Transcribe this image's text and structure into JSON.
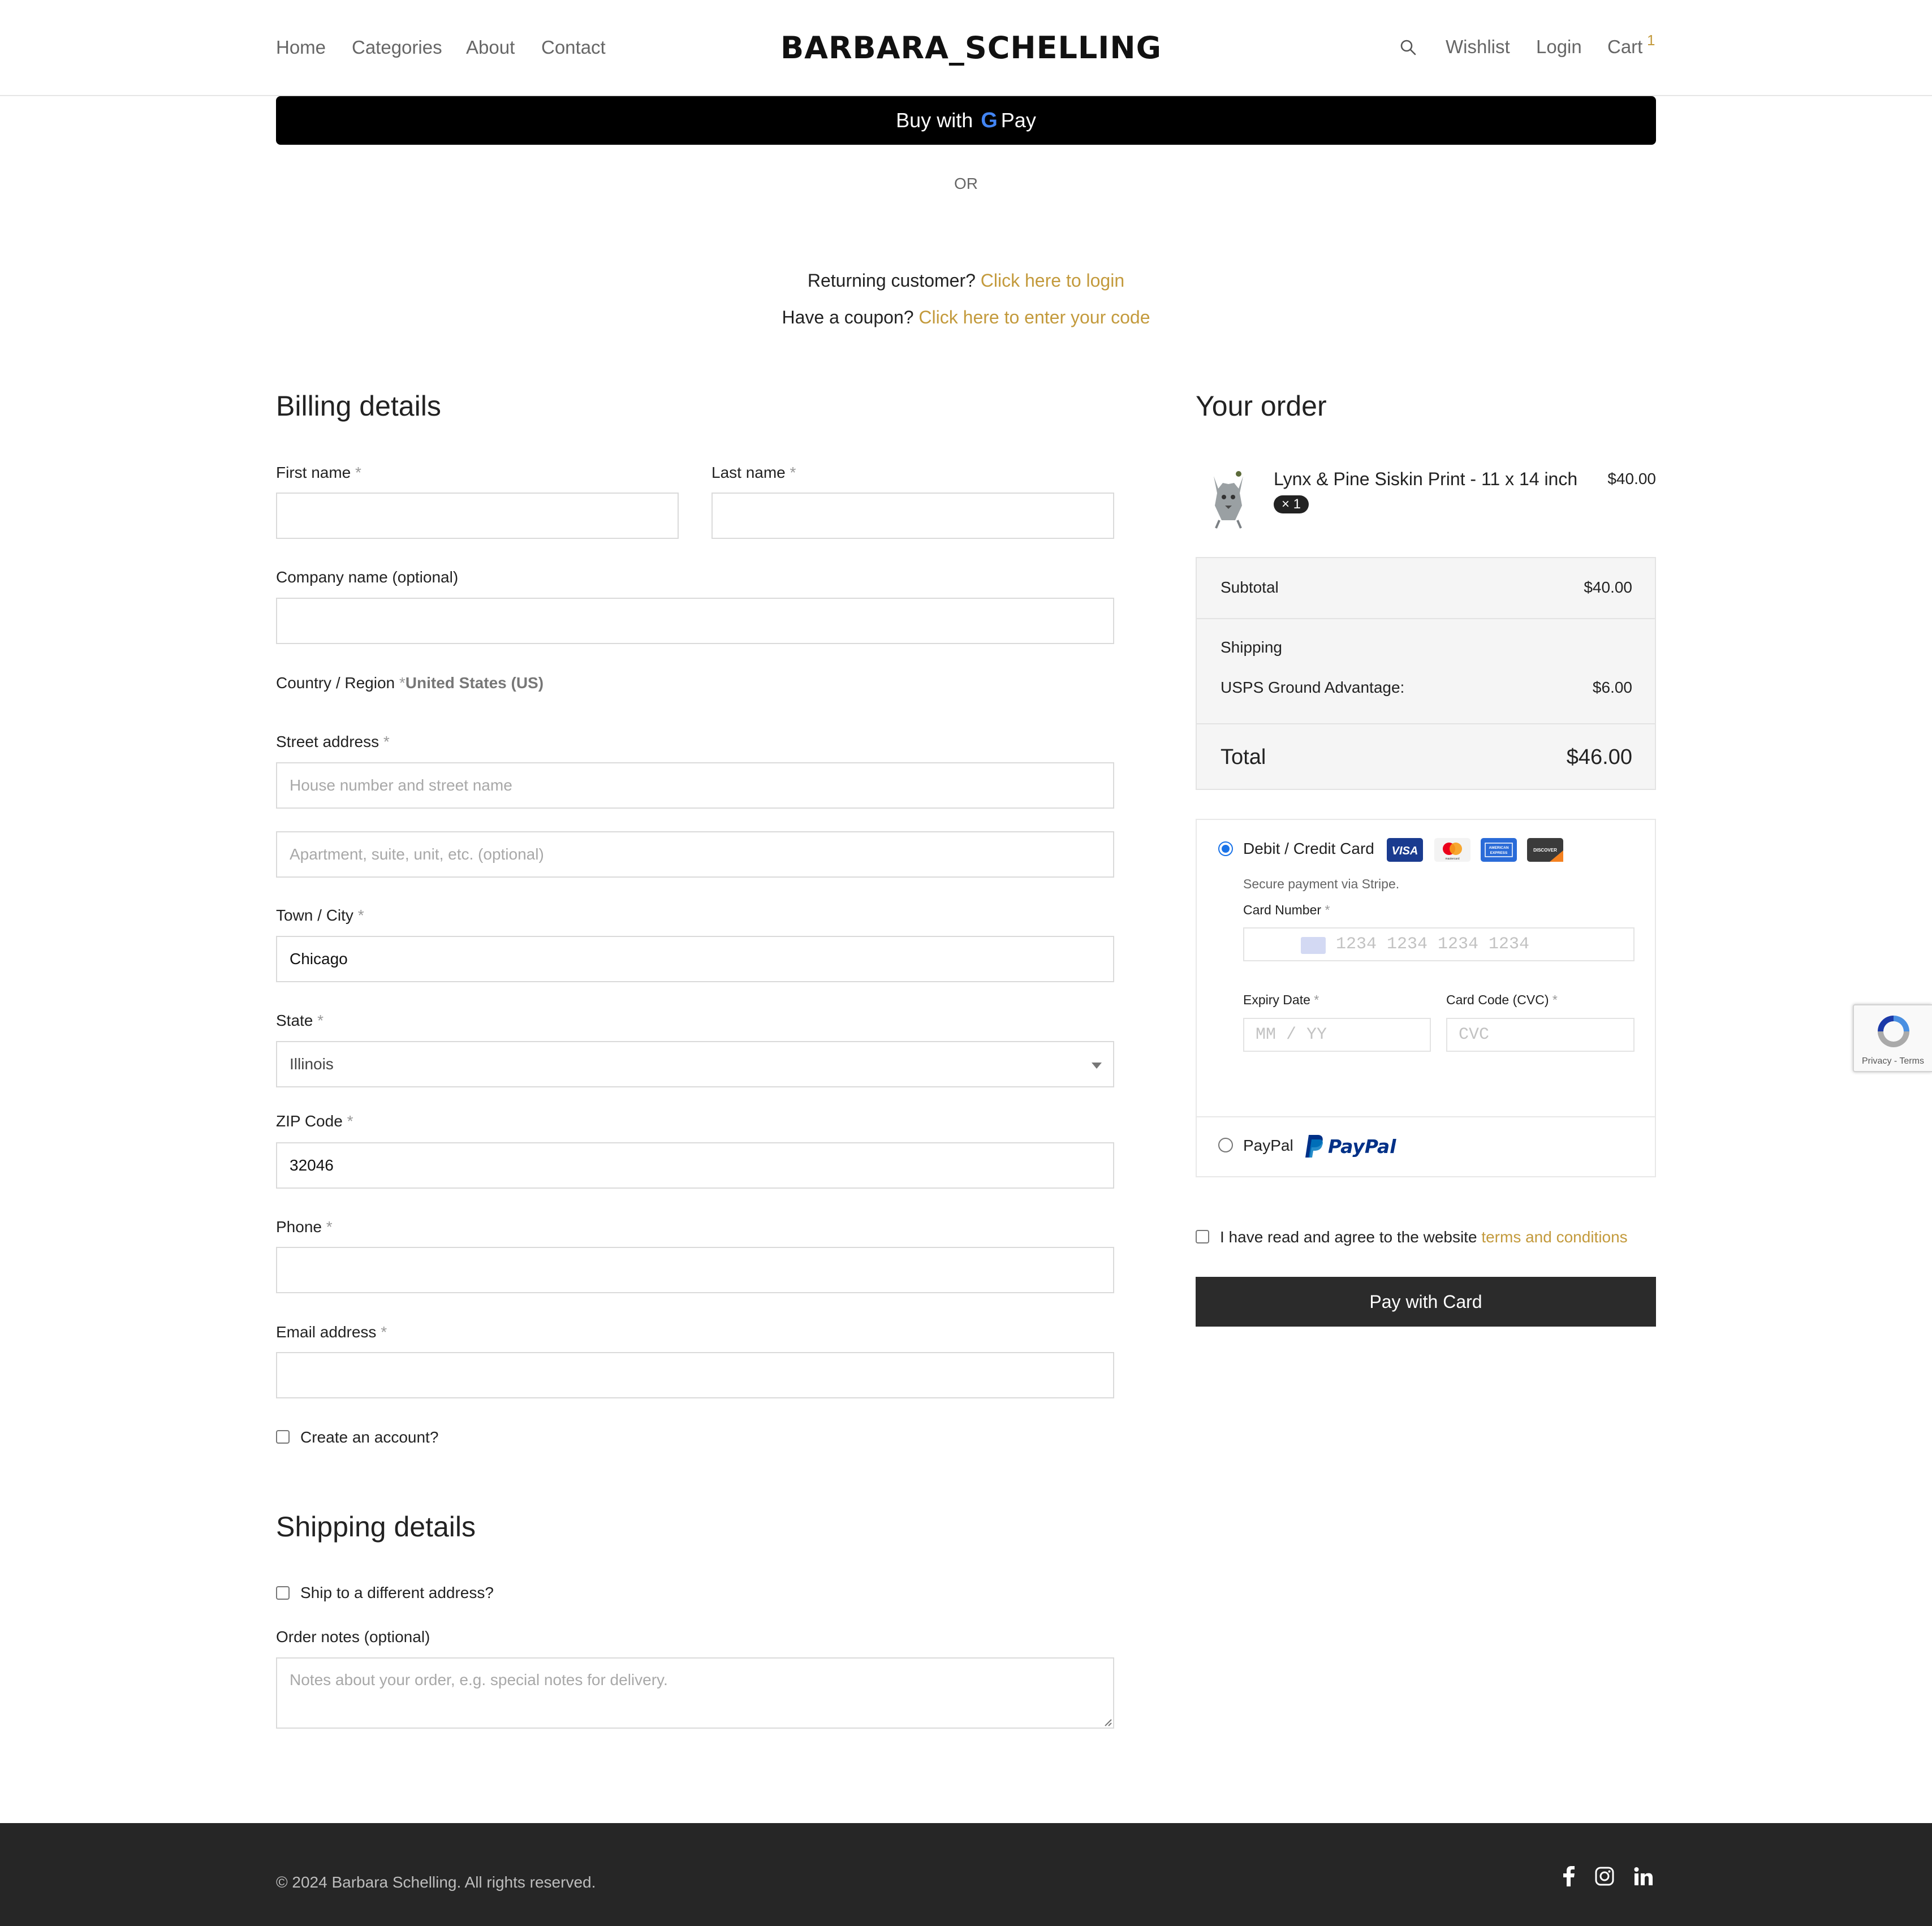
{
  "header": {
    "nav": [
      "Home",
      "Categories",
      "About",
      "Contact"
    ],
    "logo": "BARBARA_SCHELLING",
    "right_links": {
      "wishlist": "Wishlist",
      "login": "Login",
      "cart": "Cart"
    },
    "cart_count": "1",
    "icons": {
      "search": "search-icon"
    }
  },
  "express": {
    "gpay_prefix": "Buy with",
    "gpay_g": "G",
    "gpay_suffix": "Pay",
    "or": "OR"
  },
  "notices": {
    "returning_text": "Returning customer?",
    "returning_link": "Click here to login",
    "coupon_text": "Have a coupon?",
    "coupon_link": "Click here to enter your code"
  },
  "billing": {
    "title": "Billing details",
    "first_name_label": "First name",
    "last_name_label": "Last name",
    "company_label": "Company name (optional)",
    "country_label": "Country / Region",
    "country_value": "United States (US)",
    "street_label": "Street address",
    "street_placeholder": "House number and street name",
    "apt_placeholder": "Apartment, suite, unit, etc. (optional)",
    "city_label": "Town / City",
    "city_value": "Chicago",
    "state_label": "State",
    "state_value": "Illinois",
    "zip_label": "ZIP Code",
    "zip_value": "32046",
    "phone_label": "Phone",
    "email_label": "Email address",
    "create_account_label": "Create an account?",
    "required_mark": "*"
  },
  "shipping": {
    "title": "Shipping details",
    "different_address_label": "Ship to a different address?",
    "notes_label": "Order notes (optional)",
    "notes_placeholder": "Notes about your order, e.g. special notes for delivery."
  },
  "order": {
    "title": "Your order",
    "item_name": "Lynx & Pine Siskin Print - 11 x 14 inch",
    "item_qty": "× 1",
    "item_price": "$40.00",
    "subtotal_label": "Subtotal",
    "subtotal_value": "$40.00",
    "shipping_label": "Shipping",
    "shipping_method": "USPS Ground Advantage:",
    "shipping_value": "$6.00",
    "total_label": "Total",
    "total_value": "$46.00"
  },
  "payment": {
    "card_label": "Debit / Credit Card",
    "card_brands": [
      "VISA",
      "mastercard",
      "AMERICAN EXPRESS",
      "DISCOVER"
    ],
    "secure_note": "Secure payment via Stripe.",
    "card_number_label": "Card Number",
    "card_number_placeholder": "1234 1234 1234 1234",
    "expiry_label": "Expiry Date",
    "expiry_placeholder": "MM / YY",
    "cvc_label": "Card Code (CVC)",
    "cvc_placeholder": "CVC",
    "paypal_label": "PayPal",
    "paypal_logo_text": "PayPal",
    "terms_text": "I have read and agree to the website",
    "terms_link": "terms and conditions",
    "pay_button": "Pay with Card"
  },
  "recaptcha": {
    "privacy": "Privacy",
    "sep": "-",
    "terms": "Terms"
  },
  "footer": {
    "copyright": "© 2024 Barbara Schelling. All rights reserved.",
    "social_icons": [
      "facebook-icon",
      "instagram-icon",
      "linkedin-icon"
    ]
  },
  "colors": {
    "accent": "#c39a3c",
    "footer_bg": "#262626",
    "pay_button_bg": "#2b2b2b",
    "radio_selected": "#1a73e8"
  }
}
